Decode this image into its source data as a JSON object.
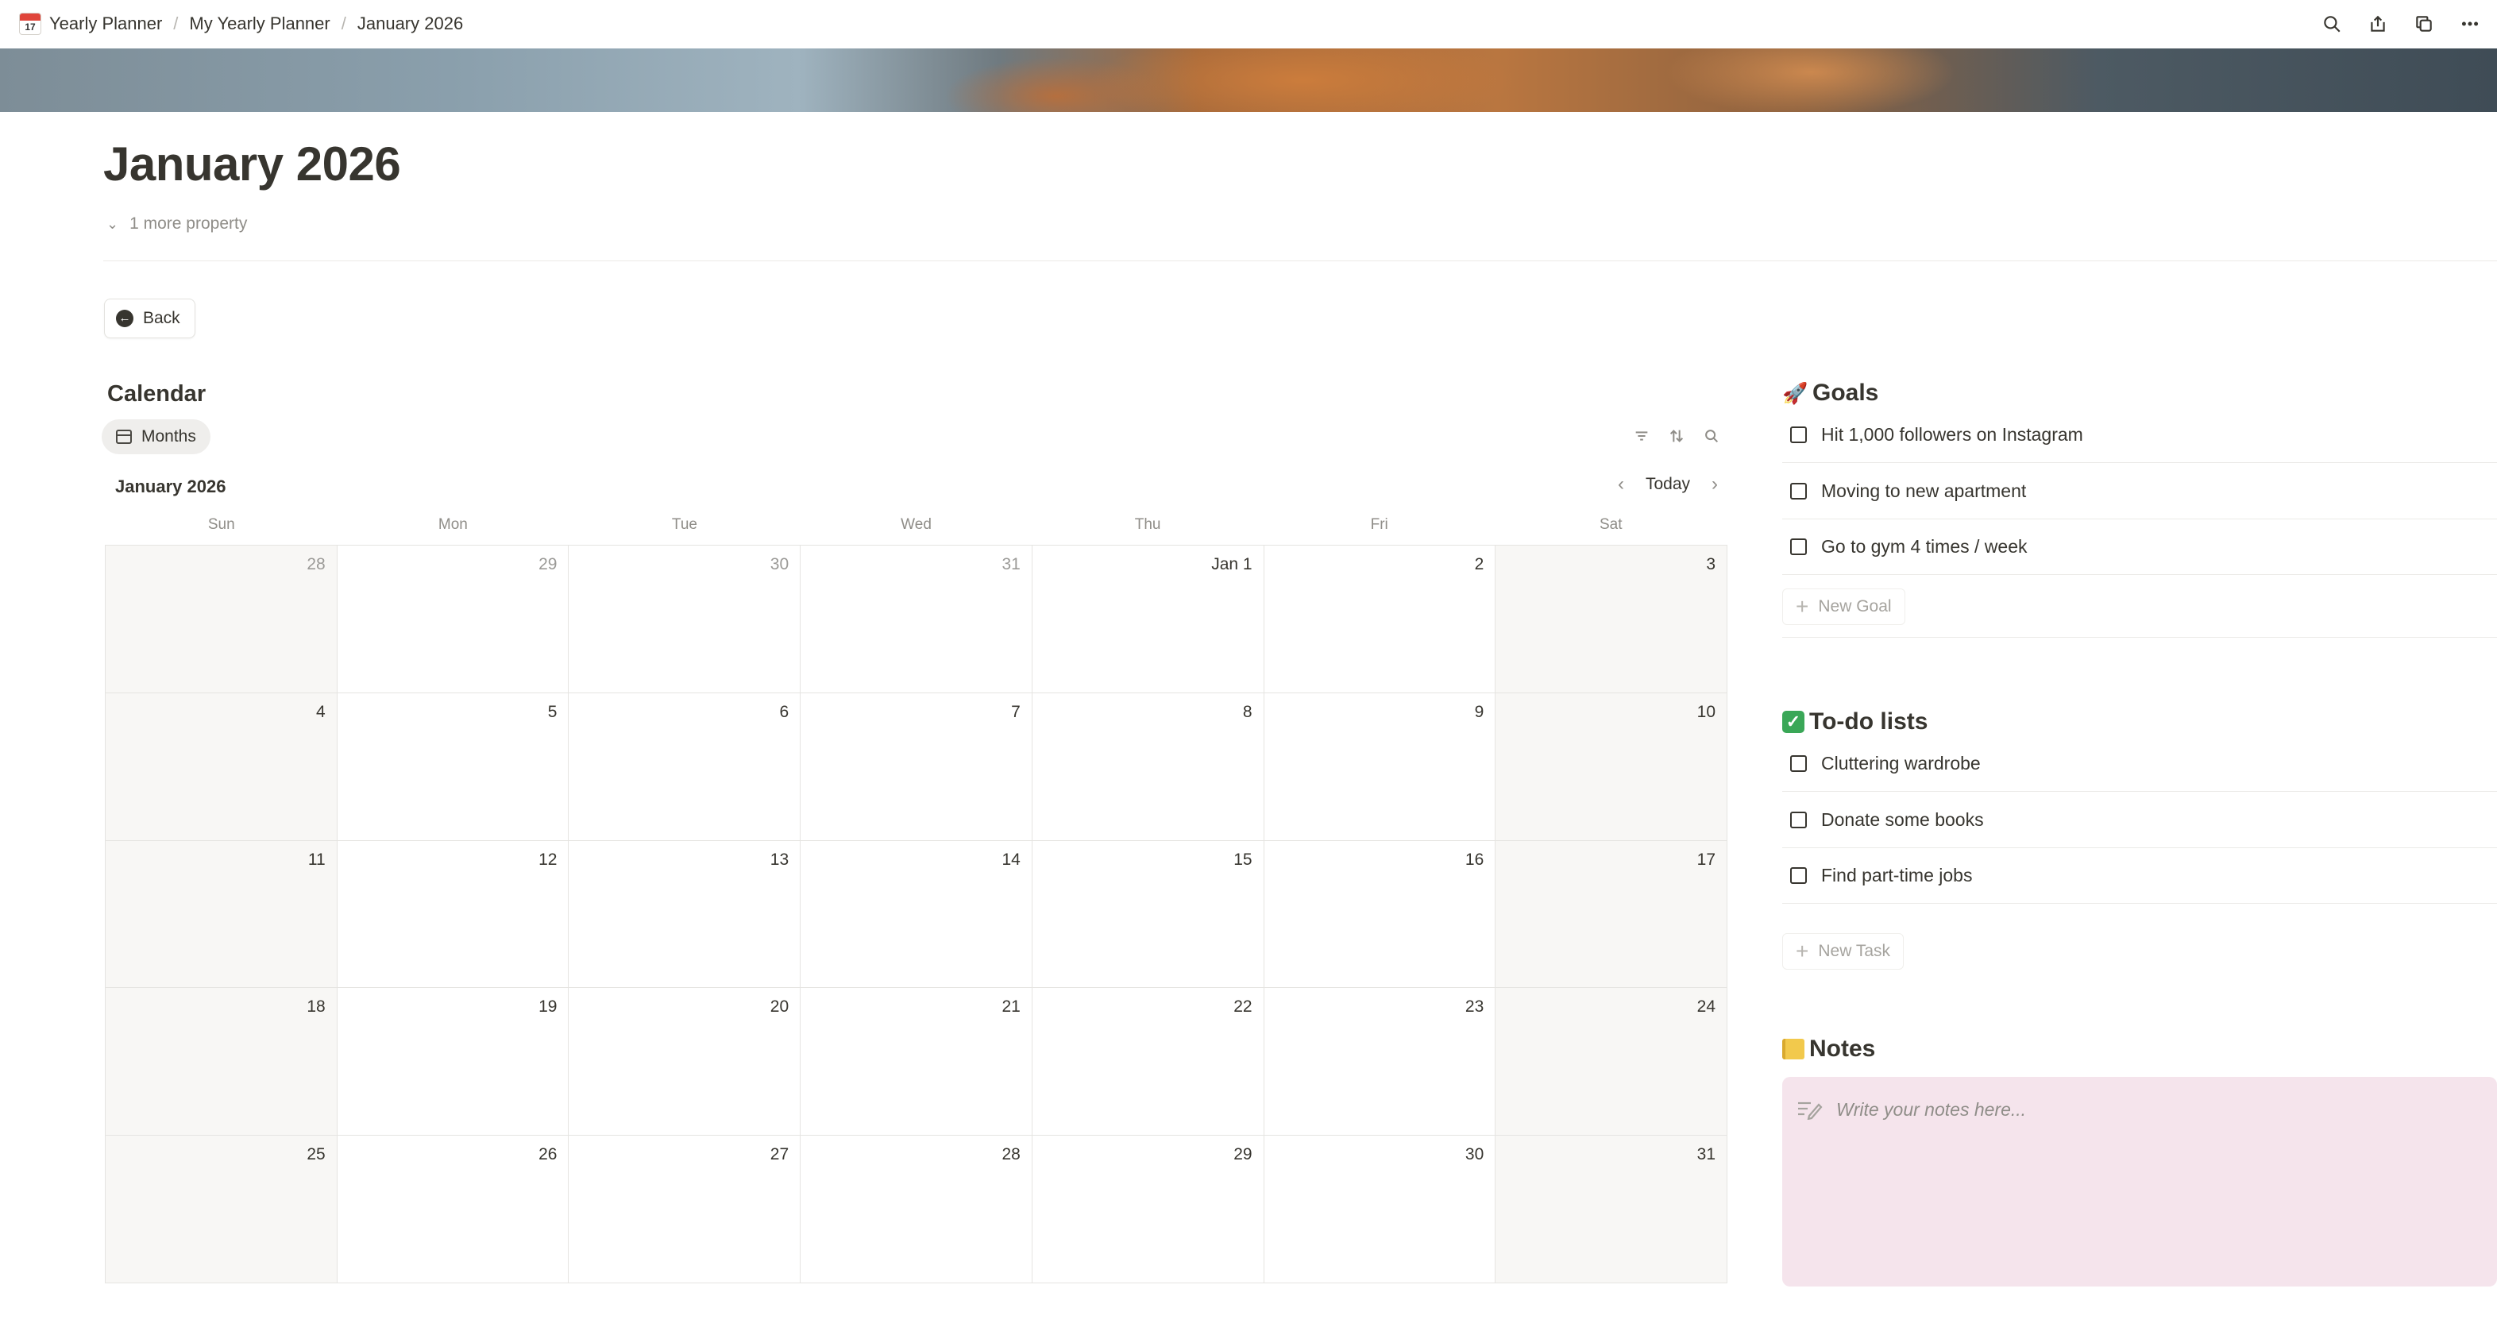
{
  "breadcrumb": {
    "items": [
      "Yearly Planner",
      "My Yearly Planner",
      "January 2026"
    ],
    "separator": "/",
    "icon": "calendar-emoji-icon",
    "icon_text": "17"
  },
  "topbar": {
    "icons": [
      "search-icon",
      "share-icon",
      "duplicate-icon",
      "more-icon"
    ]
  },
  "page": {
    "title": "January 2026",
    "more_property": "1 more property",
    "back_label": "Back"
  },
  "calendar": {
    "title": "Calendar",
    "view_label": "Months",
    "month_label": "January 2026",
    "today_label": "Today",
    "weekdays": [
      "Sun",
      "Mon",
      "Tue",
      "Wed",
      "Thu",
      "Fri",
      "Sat"
    ],
    "weeks": [
      [
        "28",
        "29",
        "30",
        "31",
        "Jan 1",
        "2",
        "3"
      ],
      [
        "4",
        "5",
        "6",
        "7",
        "8",
        "9",
        "10"
      ],
      [
        "11",
        "12",
        "13",
        "14",
        "15",
        "16",
        "17"
      ],
      [
        "18",
        "19",
        "20",
        "21",
        "22",
        "23",
        "24"
      ],
      [
        "25",
        "26",
        "27",
        "28",
        "29",
        "30",
        "31"
      ]
    ]
  },
  "goals": {
    "title": "Goals",
    "emoji": "🚀",
    "items": [
      "Hit 1,000 followers on Instagram",
      "Moving to new apartment",
      "Go to gym 4 times / week"
    ],
    "new_label": "New Goal"
  },
  "todos": {
    "title": "To-do lists",
    "emoji": "✓",
    "items": [
      "Cluttering wardrobe",
      "Donate some books",
      "Find part-time jobs"
    ],
    "new_label": "New Task"
  },
  "notes": {
    "title": "Notes",
    "placeholder": "Write your notes here..."
  }
}
